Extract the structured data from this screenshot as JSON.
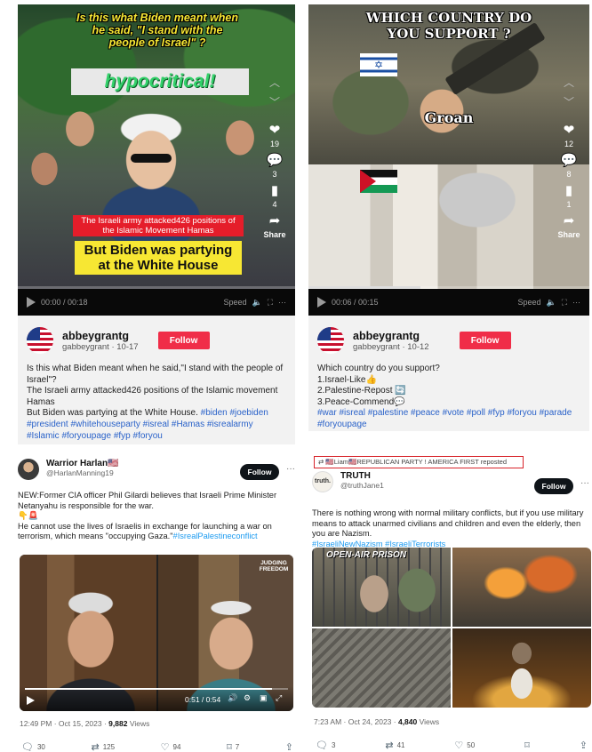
{
  "left_video_post": {
    "overlay_question": "Is this what Biden meant when he said,  \"I stand with the people of Israel\" ?",
    "overlay_banner": "hypocritical!",
    "overlay_caption_red": "The Israeli army attacked426 positions of the Islamic Movement Hamas",
    "overlay_caption_yellow": "But Biden was partying at the White House",
    "actions": {
      "likes": "19",
      "comments": "3",
      "saves": "4",
      "share": "Share"
    },
    "player": {
      "time": "00:00 / 00:18",
      "speed": "Speed",
      "progress": 0.0
    },
    "author": {
      "name": "abbeygrantg",
      "meta": "gabbeygrant · 10-17"
    },
    "follow_label": "Follow",
    "text_lines": [
      "Is this what Biden meant when he said,\"I stand with the people of Israel\"?",
      "The Israeli army attacked426 positions of the Islamic movement Hamas",
      "But Biden was partying at the White House."
    ],
    "tags": "#biden #joebiden #president #whitehouseparty #isreal #Hamas #isrealarmy #Islamic #foryoupage #fyp #foryou"
  },
  "right_video_post": {
    "overlay_question": "WHICH COUNTRY DO YOU SUPPORT ?",
    "overlay_word": "Groan",
    "actions": {
      "likes": "12",
      "comments": "8",
      "saves": "1",
      "share": "Share"
    },
    "player": {
      "time": "00:06 / 00:15",
      "speed": "Speed",
      "progress": 0.4
    },
    "author": {
      "name": "abbeygrantg",
      "meta": "gabbeygrant · 10-12"
    },
    "follow_label": "Follow",
    "text_lines": [
      "Which country do you support?",
      "1.Israel-Like👍",
      "2.Palestine-Repost 🔄",
      "3.Peace-Commend💬"
    ],
    "tags": "#war #isreal #palestine #peace #vote #poll #fyp #foryou #parade #foryoupage"
  },
  "left_tweet": {
    "name": "Warrior Harlan🇺🇸",
    "handle": "@HarlanManning19",
    "follow_label": "Follow",
    "text_1": "NEW:Former CIA officer Phil Gilardi believes that Israeli Prime Minister Netanyahu is responsible for the war.",
    "emojis": "👇🚨",
    "text_2": "He cannot use the lives of Israelis in exchange for launching a war on terrorism, which means \"occupying Gaza.\"",
    "hashtag": "#IsrealPalestineconflict",
    "video_watermark": "JUDGING FREEDOM",
    "video_time": "0:51 / 0:54",
    "video_progress": 0.94,
    "timestamp": "12:49 PM · Oct 15, 2023 · ",
    "views_count": "9,882",
    "views_label": " Views",
    "replies": "30",
    "reposts": "125",
    "likes": "94",
    "bookmarks": "7"
  },
  "right_tweet": {
    "reposted_by": "🇺🇸Liam🇺🇸REPUBLICAN PARTY ! AMERICA FIRST reposted",
    "avatar_text": "truth.",
    "name": "TRUTH",
    "handle": "@truthJane1",
    "follow_label": "Follow",
    "text": "There is nothing wrong with normal military conflicts, but if you use military means to attack unarmed civilians and children and even the elderly, then you are Nazism.",
    "hashtags": "#IsraeliNewNazism #IsraeliTerrorists",
    "image_caption": "OPEN-AIR PRISON",
    "timestamp": "7:23 AM · Oct 24, 2023 · ",
    "views_count": "4,840",
    "views_label": " Views",
    "replies": "3",
    "reposts": "41",
    "likes": "50"
  },
  "colors": {
    "tiktok_red": "#f02d48",
    "link_blue": "#2a62c9",
    "twitter_blue": "#1d9bf0",
    "overlay_yellow": "#f7e733",
    "overlay_green": "#33d16a",
    "caption_red": "#e51d2a"
  }
}
